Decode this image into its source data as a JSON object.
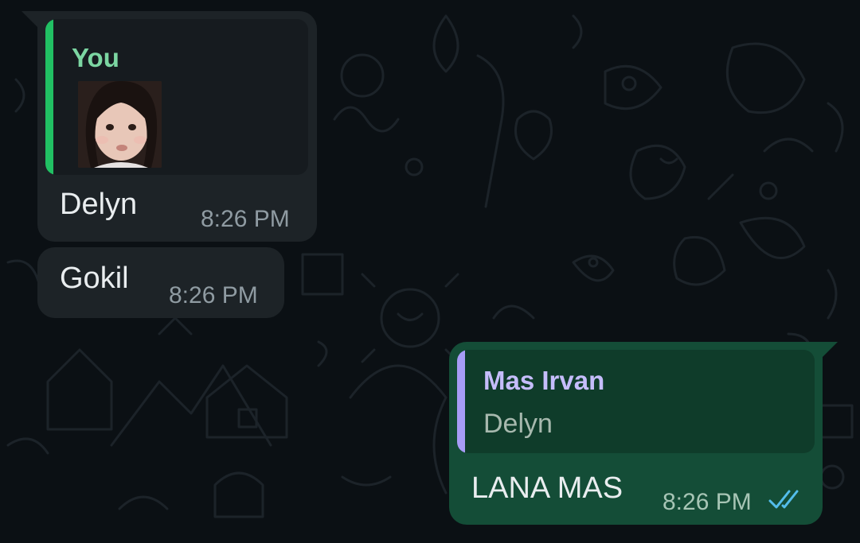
{
  "messages": [
    {
      "direction": "incoming",
      "quoted": {
        "author": "You",
        "has_image": true
      },
      "text": "Delyn",
      "time": "8:26 PM"
    },
    {
      "direction": "incoming",
      "text": "Gokil",
      "time": "8:26 PM"
    },
    {
      "direction": "outgoing",
      "quoted": {
        "author": "Mas Irvan",
        "text": "Delyn"
      },
      "text": "LANA MAS",
      "time": "8:26 PM",
      "status": "read-double-check-icon"
    }
  ],
  "colors": {
    "background": "#0b1014",
    "incoming_bubble": "#1d2327",
    "outgoing_bubble": "#144d37",
    "quote_bar_you": "#21c063",
    "quote_bar_other": "#a79cf6",
    "read_ticks": "#53bdeb"
  }
}
